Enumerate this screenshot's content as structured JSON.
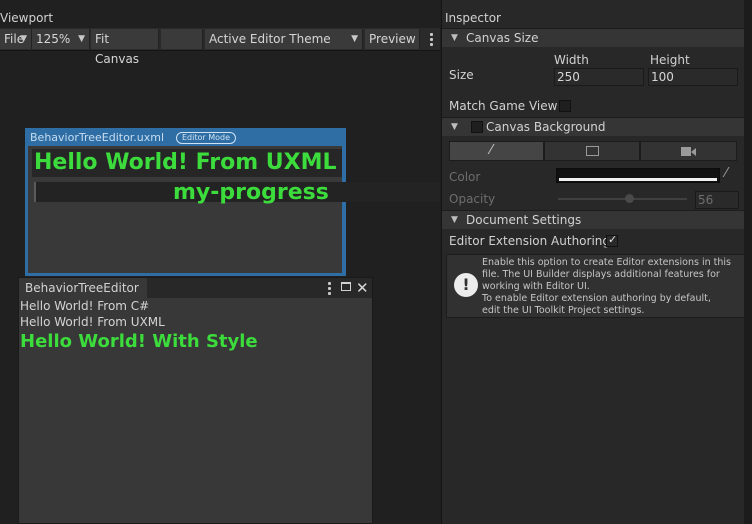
{
  "viewport": {
    "tab_label": "Viewport",
    "toolbar": {
      "file": "File",
      "zoom": "125%",
      "fit_canvas": "Fit Canvas",
      "theme": "Active Editor Theme",
      "preview": "Preview"
    }
  },
  "canvas": {
    "document_name": "BehaviorTreeEditor.uxml",
    "mode_badge": "Editor Mode",
    "title": "Hello World! From UXML",
    "progress_label": "my-progress",
    "progress_value": 0
  },
  "editor_window": {
    "tab_label": "BehaviorTreeEditor",
    "lines": [
      "Hello World! From C#",
      "Hello World! From UXML"
    ],
    "styled_line": "Hello World! With Style"
  },
  "inspector": {
    "tab_label": "Inspector",
    "canvas_size": {
      "header": "Canvas Size",
      "size_label": "Size",
      "width_label": "Width",
      "width_value": "250",
      "height_label": "Height",
      "height_value": "100",
      "match_game_view": "Match Game View"
    },
    "canvas_background": {
      "header": "Canvas Background",
      "color_label": "Color",
      "opacity_label": "Opacity",
      "opacity_value": "56"
    },
    "document_settings": {
      "header": "Document Settings",
      "editor_extension_label": "Editor Extension Authoring",
      "editor_extension_checked": true,
      "info_lines": [
        "Enable this option to create Editor extensions in this",
        "file. The UI Builder displays additional features for",
        "working with Editor UI.",
        "To enable Editor extension authoring by default,",
        "edit the UI Toolkit Project settings."
      ]
    }
  },
  "colors": {
    "accent_green": "#3cdc3c",
    "canvas_frame_blue": "#2f6ea5"
  }
}
